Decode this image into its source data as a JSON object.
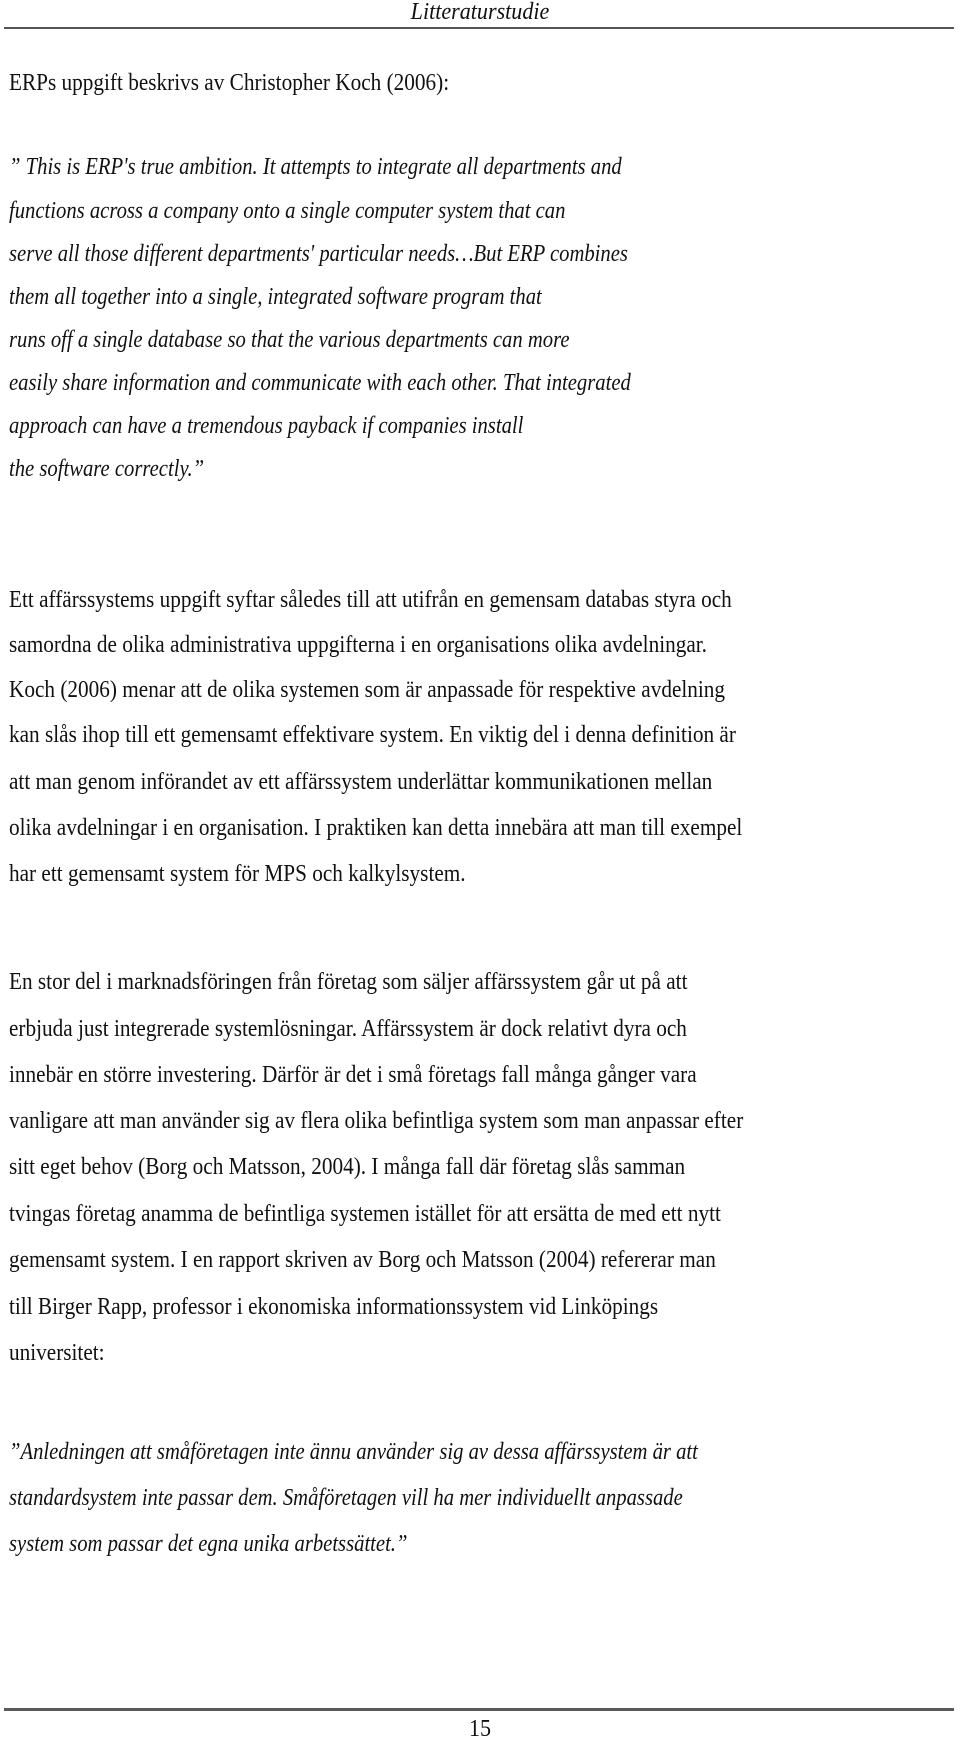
{
  "header": {
    "title": "Litteraturstudie"
  },
  "intro": "ERPs uppgift beskrivs av Christopher Koch (2006):",
  "quote1": [
    "” This is ERP's true ambition. It attempts to integrate all departments and",
    "functions across a company onto a single computer system that can",
    "serve all those different departments' particular needs…But ERP combines",
    "them all together into a single, integrated software program that",
    "runs off a single database so that the various departments can more",
    "easily share information and communicate with each other. That integrated",
    "approach can have a tremendous payback if companies install",
    "the software correctly.”"
  ],
  "paragraph1": [
    "Ett affärssystems uppgift syftar således till att utifrån en gemensam databas styra och",
    "samordna de olika administrativa uppgifterna i en organisations olika avdelningar.",
    "Koch (2006) menar att de olika systemen som är anpassade för respektive avdelning",
    "kan slås ihop till ett gemensamt effektivare system. En viktig del i denna definition är",
    "att man genom införandet av ett affärssystem underlättar kommunikationen mellan",
    "olika avdelningar i en organisation. I praktiken kan detta innebära att man till exempel",
    "har ett gemensamt system för MPS och kalkylsystem."
  ],
  "paragraph2": [
    "En stor del i marknadsföringen från företag som säljer affärssystem går ut på att",
    "erbjuda just integrerade systemlösningar. Affärssystem är dock relativt dyra och",
    "innebär en större investering. Därför är det i små företags fall många gånger vara",
    "vanligare att man använder sig av flera olika befintliga system som man anpassar efter",
    "sitt eget behov (Borg och Matsson, 2004). I många fall där företag slås samman",
    "tvingas företag anamma de befintliga systemen istället för att ersätta de med ett nytt",
    "gemensamt system. I en rapport skriven av Borg och Matsson (2004) refererar man",
    "till Birger Rapp, professor i ekonomiska informationssystem vid Linköpings",
    "universitet:"
  ],
  "quote2": [
    "”Anledningen att småföretagen inte ännu använder sig av dessa affärssystem är att",
    "standardsystem inte passar dem. Småföretagen vill ha mer individuellt anpassade",
    "system som passar det egna unika arbetssättet.”"
  ],
  "footer": {
    "page_number": "15"
  }
}
